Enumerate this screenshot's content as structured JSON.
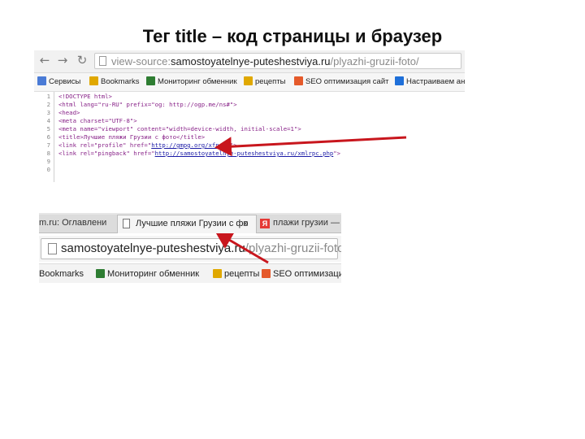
{
  "slide": {
    "title": "Тег title – код страницы и браузер"
  },
  "source_view": {
    "url_prefix": "view-source:",
    "url_domain": "samostoyatelnye-puteshestviya.ru",
    "url_path": "/plyazhi-gruzii-foto/",
    "bookmarks": [
      "Сервисы",
      "Bookmarks",
      "Мониторинг обменник",
      "рецепты",
      "SEO оптимизация сайт",
      "Настраиваем ана"
    ],
    "code_lines": [
      {
        "n": "1",
        "text": "<!DOCTYPE html>"
      },
      {
        "n": "2",
        "text": "<html lang=\"ru-RU\" prefix=\"og: http://ogp.me/ns#\">"
      },
      {
        "n": "3",
        "text": "<head>"
      },
      {
        "n": "4",
        "text": "<meta charset=\"UTF-8\">"
      },
      {
        "n": "5",
        "text": "<meta name=\"viewport\" content=\"width=device-width, initial-scale=1\">"
      },
      {
        "n": "6",
        "text": "<title>Лучшие пляжи Грузии с фото</title>"
      },
      {
        "n": "7",
        "pre": "<link rel=\"profile\" href=\"",
        "link": "http://gmpg.org/xfn/11",
        "post": "\">"
      },
      {
        "n": "8",
        "pre": "<link rel=\"pingback\" href=\"",
        "link": "http://samostoyatelnye-puteshestviya.ru/xmlrpc.php",
        "post": "\">"
      },
      {
        "n": "9",
        "text": ""
      },
      {
        "n": "0",
        "text": ""
      }
    ]
  },
  "browser": {
    "tabs": [
      {
        "label": "m.ru: Оглавлени",
        "close": "✕"
      },
      {
        "label": "Лучшие пляжи Грузии с фо",
        "close": "x"
      },
      {
        "label": "плажи грузии — Ян",
        "icon_letter": "Я"
      }
    ],
    "url_domain": "samostoyatelnye-puteshestviya.ru",
    "url_path": "/plyazhi-gruzii-foto/",
    "bookmarks": [
      "Bookmarks",
      "Мониторинг обменник",
      "рецепты",
      "SEO оптимизация са"
    ]
  },
  "colors": {
    "arrow": "#c8161d",
    "tag": "#882288",
    "link": "#1a1aa6"
  }
}
